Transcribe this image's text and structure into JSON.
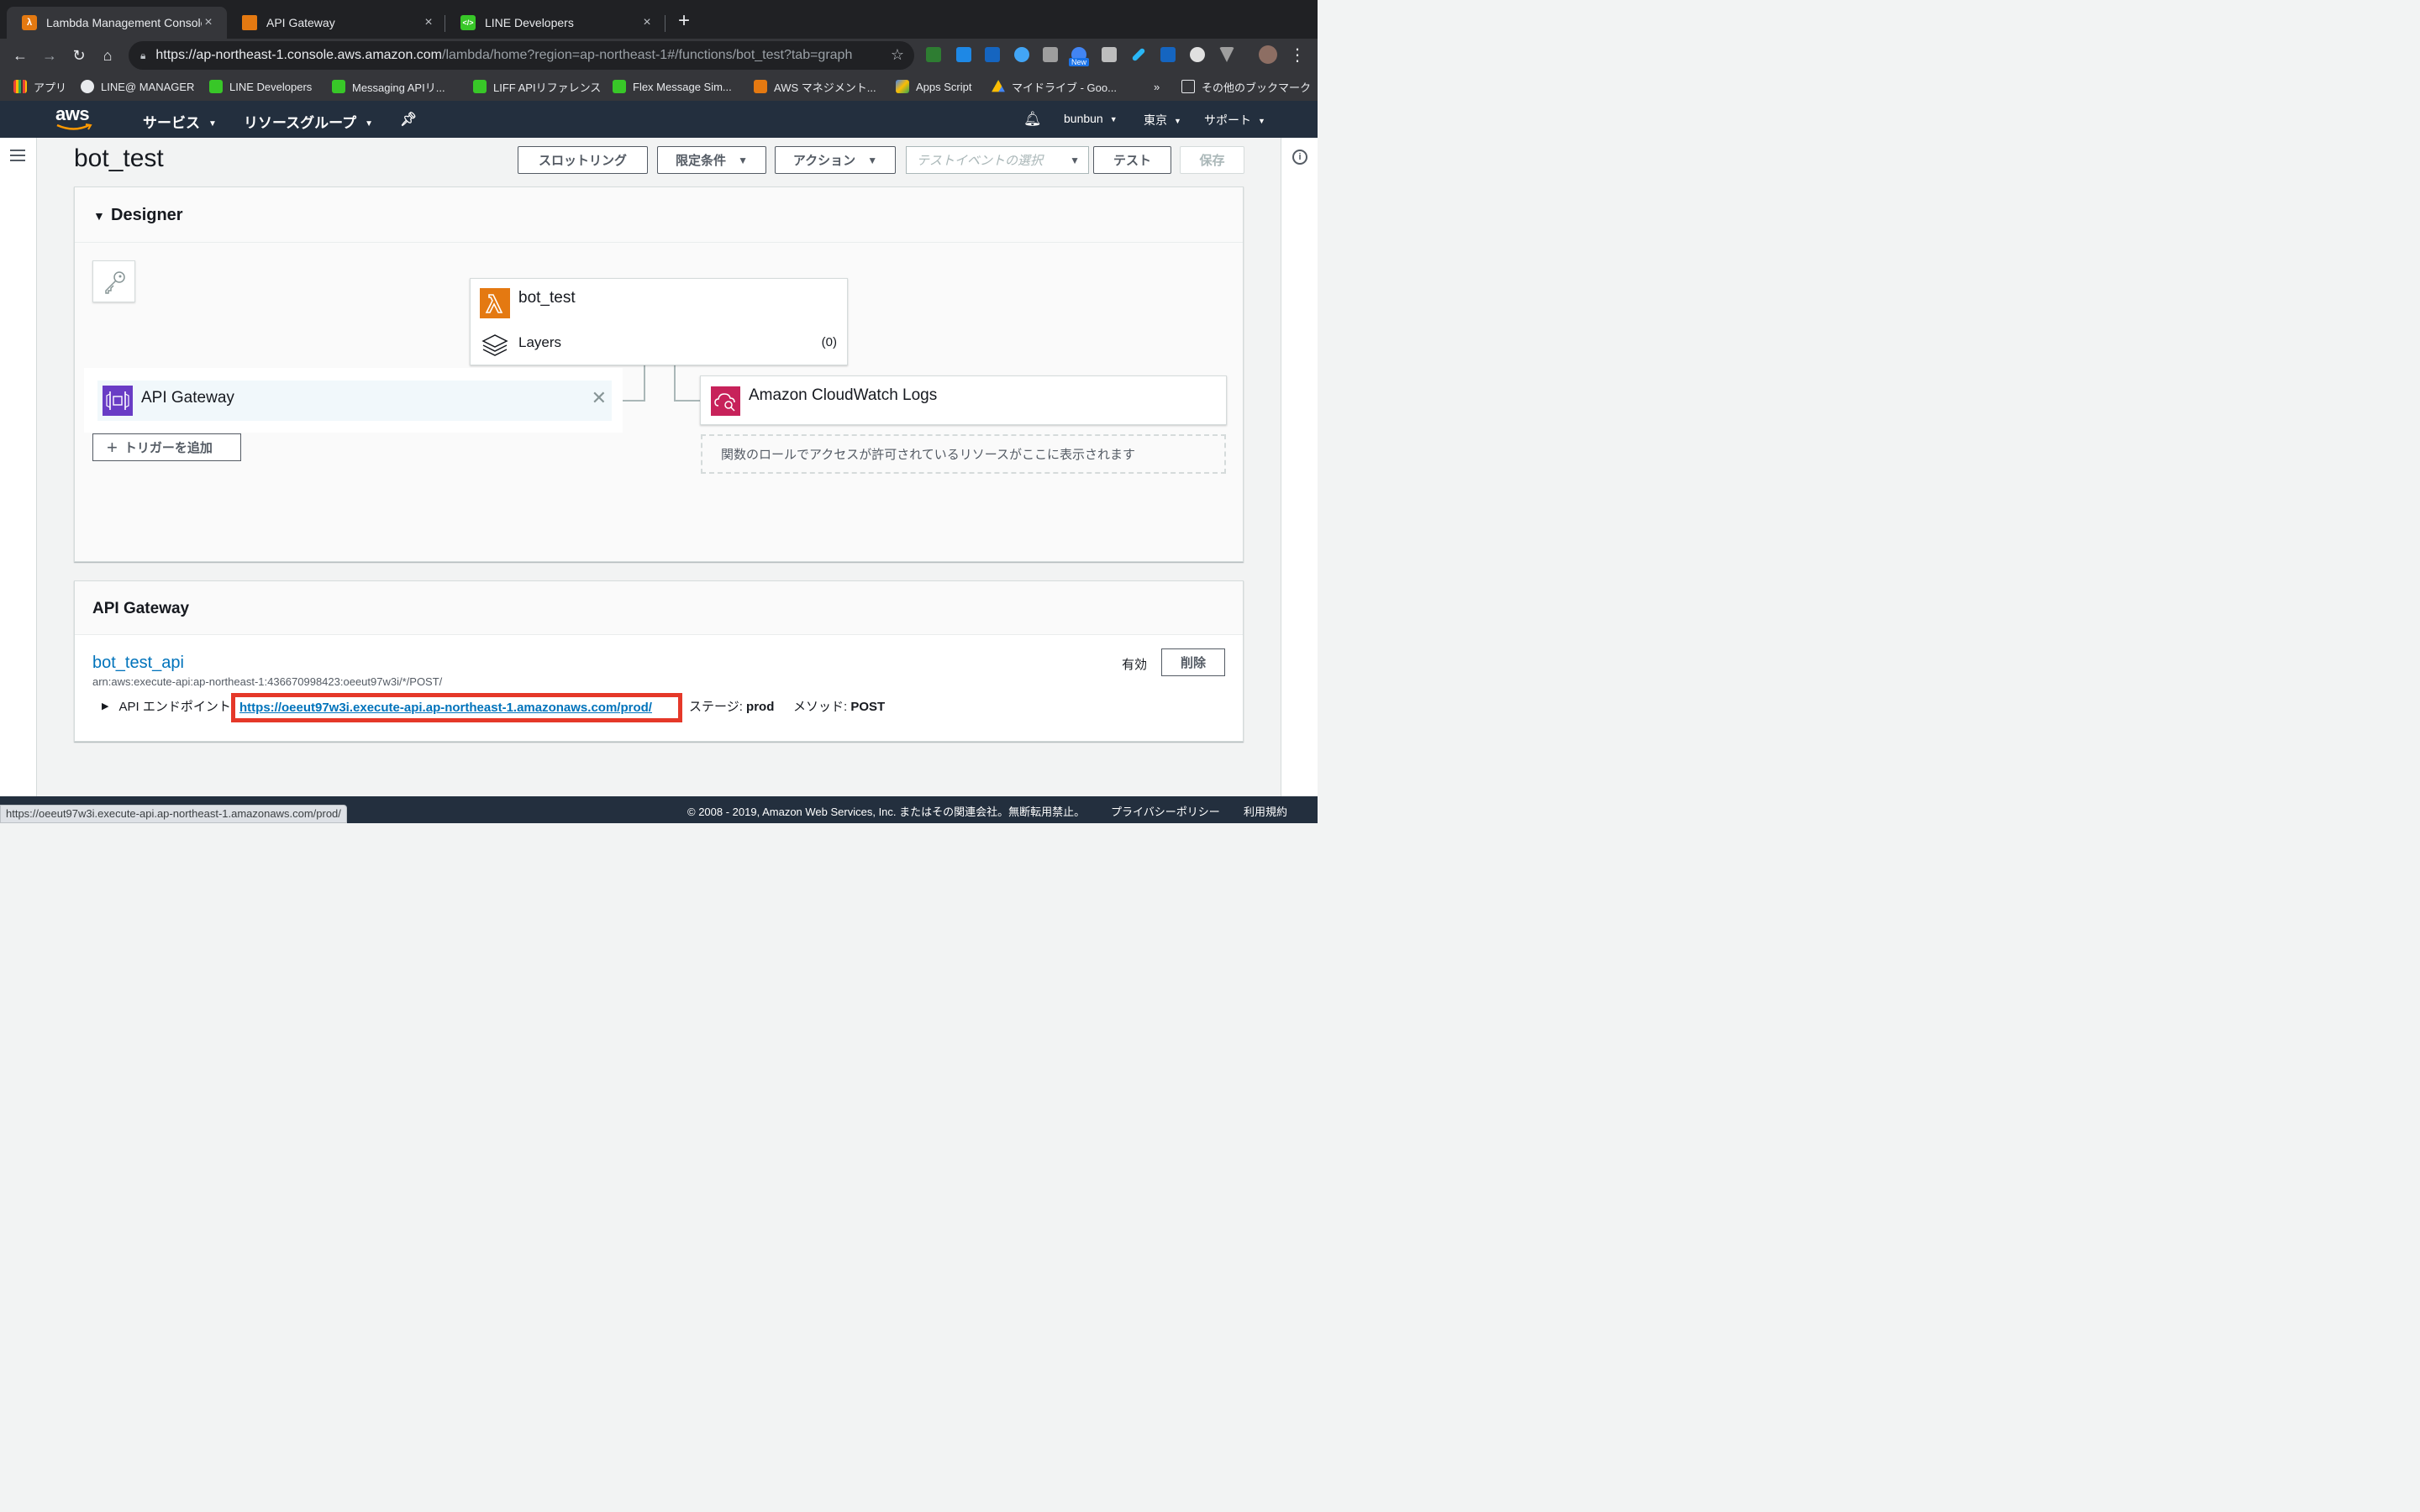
{
  "browser": {
    "tabs": [
      {
        "title": "Lambda Management Console",
        "favicon_color": "#e47911",
        "active": true
      },
      {
        "title": "API Gateway",
        "favicon_color": "#e47911",
        "active": false
      },
      {
        "title": "LINE Developers",
        "favicon_color": "#38c728",
        "active": false
      }
    ],
    "url_main": "https://ap-northeast-1.console.aws.amazon.com",
    "url_rest": "/lambda/home?region=ap-northeast-1#/functions/bot_test?tab=graph",
    "new_badge": "New",
    "bookmarks": [
      {
        "label": "アプリ",
        "icon": "apps-grid-icon"
      },
      {
        "label": "LINE@ MANAGER",
        "icon": "globe-icon"
      },
      {
        "label": "LINE Developers",
        "icon": "code-icon"
      },
      {
        "label": "Messaging APIリ...",
        "icon": "code-icon"
      },
      {
        "label": "LIFF APIリファレンス",
        "icon": "code-icon"
      },
      {
        "label": "Flex Message Sim...",
        "icon": "code-icon"
      },
      {
        "label": "AWS マネジメント...",
        "icon": "aws-cube-icon"
      },
      {
        "label": "Apps Script",
        "icon": "apps-script-icon"
      },
      {
        "label": "マイドライブ - Goo...",
        "icon": "drive-icon"
      },
      {
        "label": "その他のブックマーク",
        "icon": "folder-icon"
      }
    ],
    "bookmarks_more": "»",
    "status_url": "https://oeeut97w3i.execute-api.ap-northeast-1.amazonaws.com/prod/"
  },
  "aws_nav": {
    "logo": "aws",
    "services": "サービス",
    "resource_groups": "リソースグループ",
    "user": "bunbun",
    "region": "東京",
    "support": "サポート"
  },
  "function": {
    "name": "bot_test",
    "buttons": {
      "throttle": "スロットリング",
      "qualifiers": "限定条件",
      "actions": "アクション",
      "test_event_placeholder": "テストイベントの選択",
      "test": "テスト",
      "save": "保存"
    }
  },
  "designer": {
    "title": "Designer",
    "function_name": "bot_test",
    "layers_label": "Layers",
    "layers_count": "(0)",
    "trigger_label": "API Gateway",
    "add_trigger": "トリガーを追加",
    "destination_label": "Amazon CloudWatch Logs",
    "role_placeholder": "関数のロールでアクセスが許可されているリソースがここに表示されます"
  },
  "api_gateway_panel": {
    "title": "API Gateway",
    "api_name": "bot_test_api",
    "arn": "arn:aws:execute-api:ap-northeast-1:436670998423:oeeut97w3i/*/POST/",
    "status": "有効",
    "delete": "削除",
    "endpoint_label": "API エンドポイント",
    "endpoint_url": "https://oeeut97w3i.execute-api.ap-northeast-1.amazonaws.com/prod/",
    "stage_label": "ステージ: ",
    "stage_value": "prod",
    "method_label": "メソッド: ",
    "method_value": "POST"
  },
  "footer": {
    "copyright": "© 2008 - 2019, Amazon Web Services, Inc. またはその関連会社。無断転用禁止。",
    "privacy": "プライバシーポリシー",
    "terms": "利用規約"
  },
  "colors": {
    "aws_nav": "#232f3e",
    "link": "#0073bb",
    "highlight_box": "#e53829",
    "lambda_orange": "#e47911",
    "api_gateway_purple": "#693cc5",
    "cloudwatch_pink": "#c7225a"
  }
}
